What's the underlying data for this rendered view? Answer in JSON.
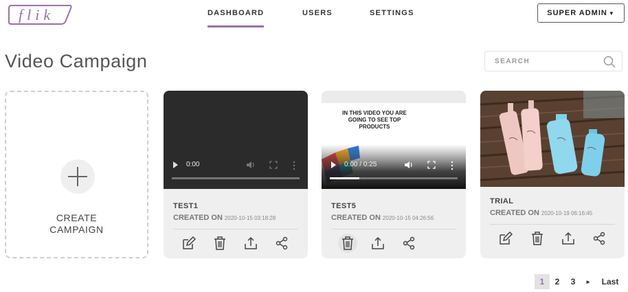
{
  "brand": {
    "logo_text": "flik",
    "accent": "#9a6fae"
  },
  "nav": {
    "tabs": [
      {
        "label": "DASHBOARD",
        "active": true
      },
      {
        "label": "USERS",
        "active": false
      },
      {
        "label": "SETTINGS",
        "active": false
      }
    ],
    "admin_label": "SUPER ADMIN"
  },
  "page": {
    "title": "Video Campaign"
  },
  "search": {
    "placeholder": "SEARCH"
  },
  "create_card": {
    "line1": "CREATE",
    "line2": "CAMPAIGN",
    "icon": "plus-icon"
  },
  "campaigns": [
    {
      "name": "TEST1",
      "created_label": "CREATED ON",
      "created_at": "2020-10-15 03:18:28",
      "media": "video",
      "video_time": "0:00",
      "progress": 0,
      "actions": [
        "edit-icon",
        "delete-icon",
        "upload-icon",
        "share-icon"
      ]
    },
    {
      "name": "TEST5",
      "created_label": "CREATED ON",
      "created_at": "2020-10-15 04:26:56",
      "media": "video",
      "video_caption": "IN THIS VIDEO YOU ARE GOING TO SEE TOP PRODUCTS",
      "video_time": "0:00 / 0:25",
      "progress": 0.23,
      "actions": [
        "delete-icon",
        "upload-icon",
        "share-icon"
      ]
    },
    {
      "name": "TRIAL",
      "created_label": "CREATED ON",
      "created_at": "2020-10-19 06:16:45",
      "media": "image",
      "image_subject": "product bottles on wood",
      "actions": [
        "edit-icon",
        "delete-icon",
        "upload-icon",
        "share-icon"
      ]
    }
  ],
  "pagination": {
    "pages": [
      "1",
      "2",
      "3"
    ],
    "current": "1",
    "next": "▸",
    "last": "Last"
  }
}
